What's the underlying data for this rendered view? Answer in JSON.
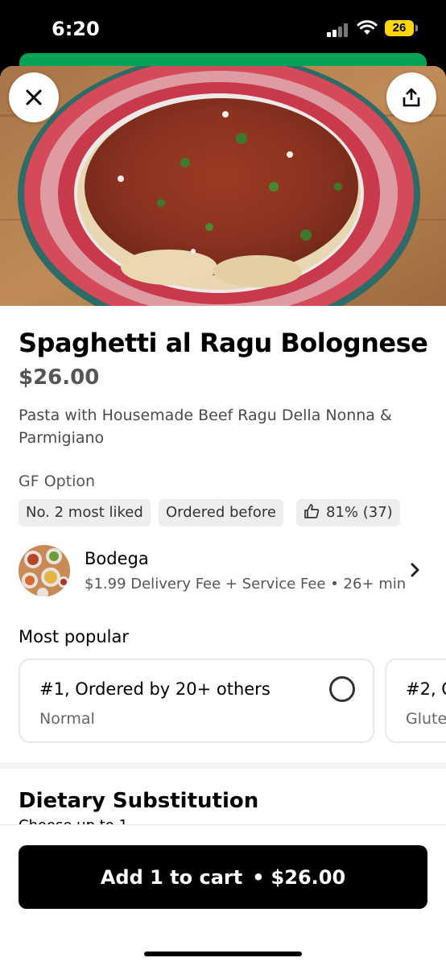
{
  "status_bar": {
    "time": "6:20",
    "battery": "26"
  },
  "item": {
    "title": "Spaghetti al Ragu Bolognese",
    "price": "$26.00",
    "description": "Pasta with Housemade Beef Ragu Della Nonna & Parmigiano",
    "dietary_note": "GF Option",
    "chips": [
      "No. 2 most liked",
      "Ordered before",
      "81% (37)"
    ]
  },
  "store": {
    "name": "Bodega",
    "meta": "$1.99 Delivery Fee + Service Fee • 26+ min"
  },
  "most_popular": {
    "label": "Most popular",
    "options": [
      {
        "title": "#1, Ordered by 20+ others",
        "subtitle": "Normal"
      },
      {
        "title": "#2, O",
        "subtitle": "Glute"
      }
    ]
  },
  "dietary_section": {
    "title": "Dietary Substitution",
    "subtitle": "Choose up to 1"
  },
  "cart_button": {
    "label": "Add 1 to cart",
    "price": "$26.00"
  }
}
